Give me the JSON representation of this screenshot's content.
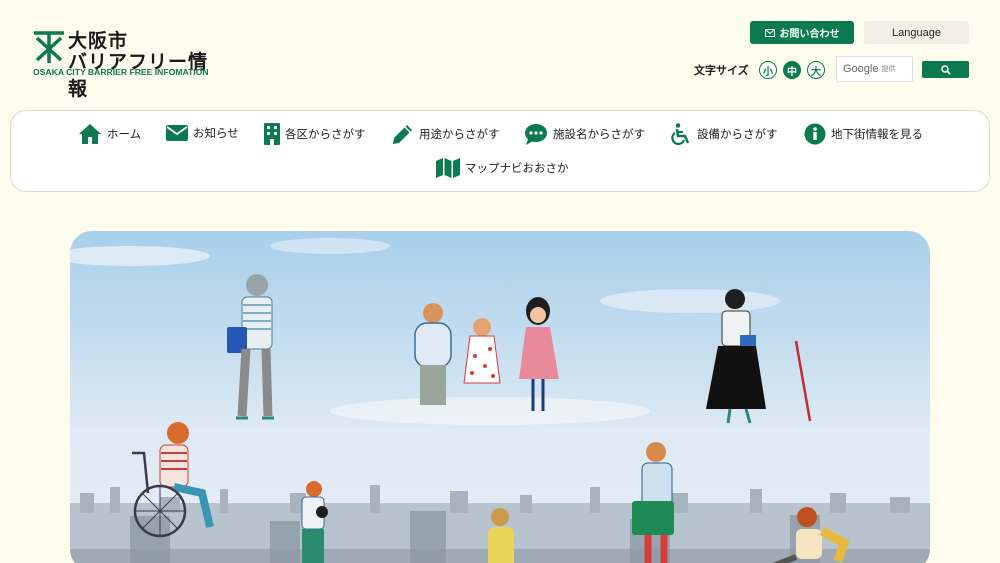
{
  "logo": {
    "title_line1": "大阪市",
    "title_line2": "バリアフリー情報",
    "subtitle": "OSAKA CITY BARRIER FREE INFOMATION"
  },
  "header": {
    "contact_label": "お問い合わせ",
    "language_label": "Language",
    "font_size_label": "文字サイズ",
    "font_sizes": [
      "小",
      "中",
      "大"
    ],
    "active_font_size": "中",
    "search_brand": "Google",
    "search_brand_suffix": "提供"
  },
  "nav": {
    "items": [
      {
        "label": "ホーム",
        "icon": "home-icon"
      },
      {
        "label": "お知らせ",
        "icon": "mail-icon"
      },
      {
        "label": "各区からさがす",
        "icon": "building-icon"
      },
      {
        "label": "用途からさがす",
        "icon": "pencil-icon"
      },
      {
        "label": "施設名からさがす",
        "icon": "speech-bubble-icon"
      },
      {
        "label": "設備からさがす",
        "icon": "wheelchair-icon"
      },
      {
        "label": "地下街情報を見る",
        "icon": "info-icon"
      },
      {
        "label": "マップナビおおさか",
        "icon": "map-icon"
      }
    ]
  },
  "colors": {
    "brand_green": "#0b7a50",
    "background": "#fefcec"
  }
}
